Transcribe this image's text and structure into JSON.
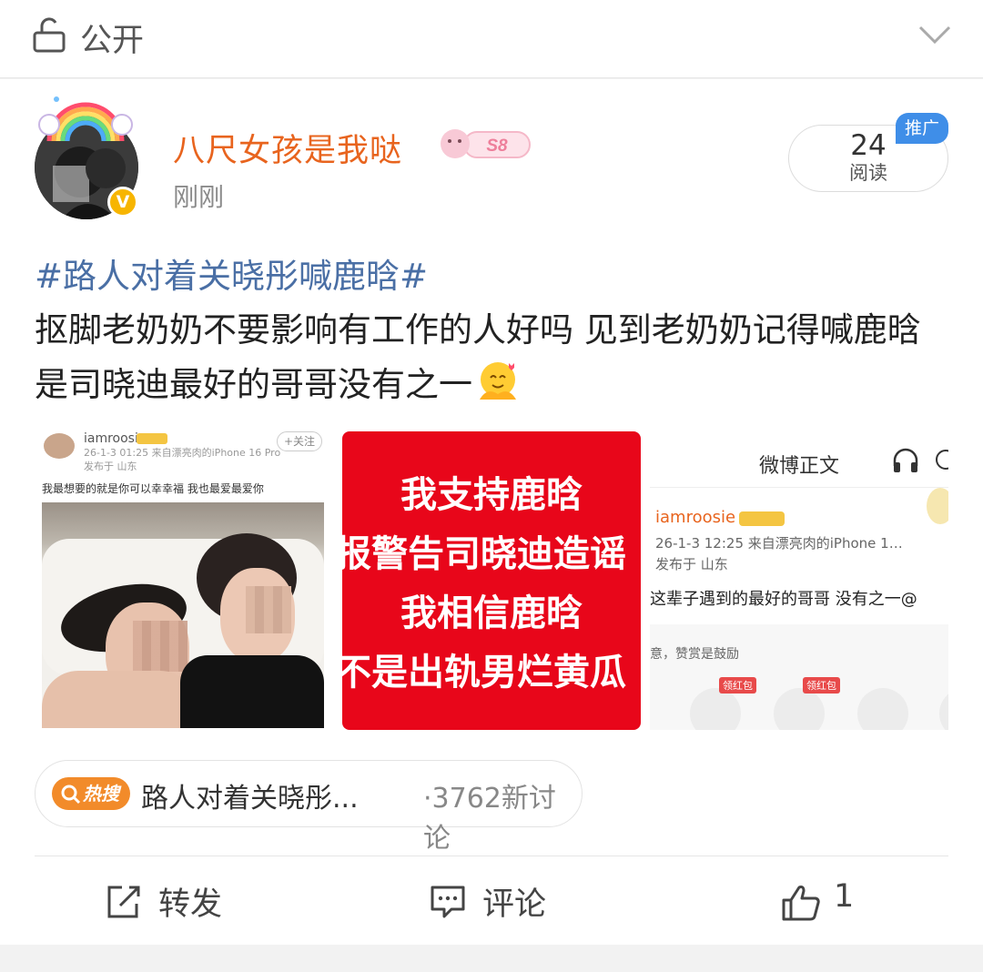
{
  "topbar": {
    "visibility": "公开",
    "lock_icon": "lock-icon",
    "expand_icon": "chevron-down-icon"
  },
  "post": {
    "username": "八尺女孩是我哒",
    "level_badge": "S8",
    "time": "刚刚",
    "verified_mark": "V",
    "reads": {
      "count": "24",
      "label": "阅读"
    },
    "promo_tag": "推广",
    "hashtag": "#路人对着关晓彤喊鹿晗#",
    "text": "抠脚老奶奶不要影响有工作的人好吗 见到老奶奶记得喊鹿晗是司晓迪最好的哥哥没有之一"
  },
  "images": {
    "image1": {
      "username": "iamroosie",
      "follow": "+关注",
      "meta_line1": "26-1-3 01:25  来自漂亮肉的iPhone 16 Pro",
      "meta_line2": "发布于 山东",
      "text": "我最想要的就是你可以幸幸福 我也最爱最爱你"
    },
    "image2": {
      "lines": [
        "我支持鹿晗",
        "报警告司晓迪造谣",
        "我相信鹿晗",
        "不是出轨男烂黄瓜"
      ]
    },
    "image3": {
      "header": "微博正文",
      "username": "iamroosie",
      "meta_line1": "26-1-3 12:25  来自漂亮肉的iPhone 1…",
      "meta_line2": "发布于 山东",
      "text": "这辈子遇到的最好的哥哥 没有之一@",
      "note": "意，赞赏是鼓励",
      "tag1": "领红包",
      "tag2": "领红包"
    }
  },
  "hot_search": {
    "badge": "热搜",
    "title": "路人对着关晓彤...",
    "count": "·3762新讨论"
  },
  "actions": {
    "repost": "转发",
    "comment": "评论",
    "like_count": "1"
  }
}
